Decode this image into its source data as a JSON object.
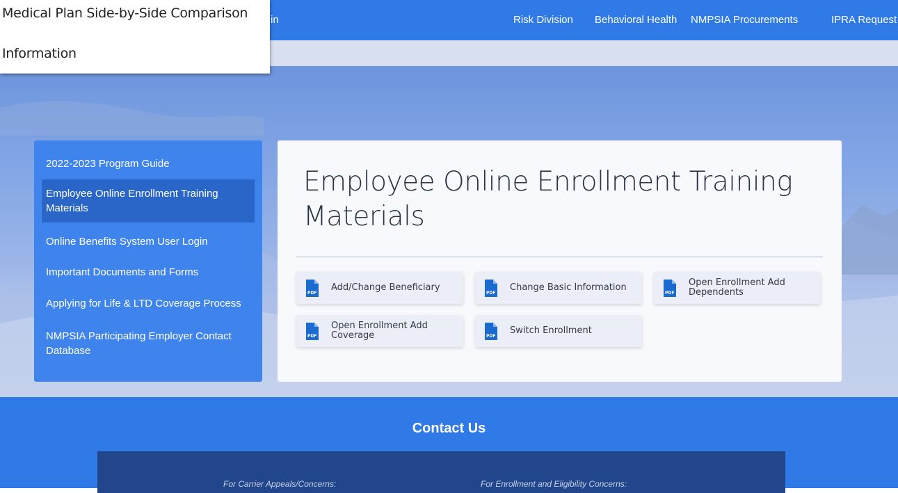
{
  "nav": {
    "partial_text": "in",
    "links": [
      "Risk Division",
      "Behavioral Health",
      "NMPSIA Procurements",
      "IPRA Request"
    ]
  },
  "dropdown": {
    "items": [
      "Medical Plan Side-by-Side Comparison",
      "Information"
    ]
  },
  "sidebar": {
    "items": [
      {
        "label": "2022-2023 Program Guide"
      },
      {
        "label": "Employee Online Enrollment Training Materials"
      },
      {
        "label": "Online Benefits System User Login"
      },
      {
        "label": "Important Documents and Forms"
      },
      {
        "label": "Applying for Life & LTD Coverage Process"
      },
      {
        "label": "NMPSIA Participating Employer Contact Database"
      }
    ]
  },
  "main": {
    "title": "Employee Online Enrollment Training Materials",
    "documents": [
      {
        "label": "Add/Change Beneficiary",
        "icon": "pdf-icon"
      },
      {
        "label": "Change Basic Information",
        "icon": "pdf-icon"
      },
      {
        "label": "Open Enrollment Add Dependents",
        "icon": "pdf-icon"
      },
      {
        "label": "Open Enrollment Add Coverage",
        "icon": "pdf-icon"
      },
      {
        "label": "Switch Enrollment",
        "icon": "pdf-icon"
      }
    ]
  },
  "contact": {
    "title": "Contact Us",
    "carrier": "For Carrier Appeals/Concerns:",
    "enrollment": "For Enrollment and Eligibility Concerns:"
  },
  "colors": {
    "nav_blue": "#2f7ae6",
    "sidebar_blue": "#3f84ec",
    "active_item": "#2a66c8",
    "contact_box": "#21468c",
    "pdf_blue": "#1a6ad0"
  }
}
